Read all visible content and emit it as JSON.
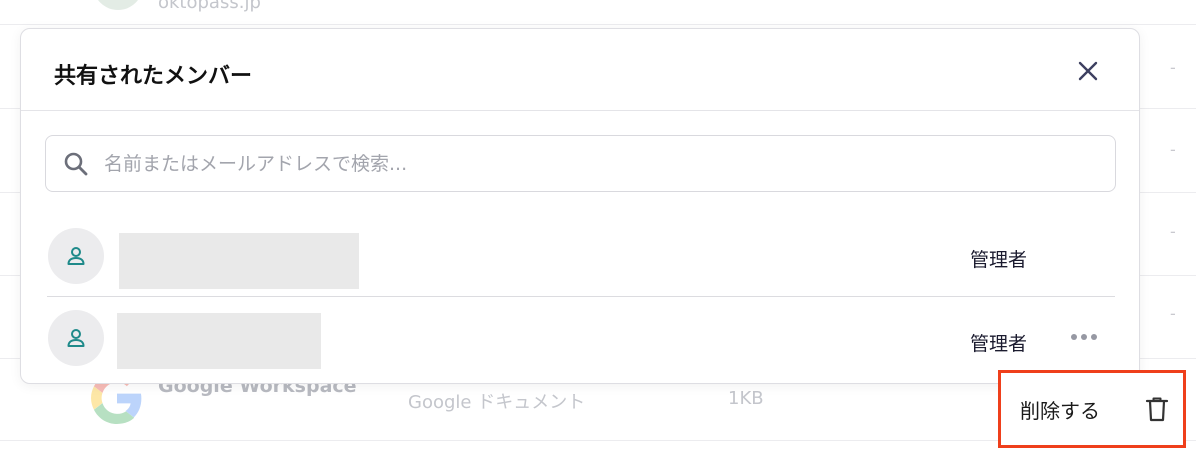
{
  "background": {
    "top_domain": "oktopass.jp",
    "row": {
      "app_name": "Google Workspace",
      "file_type": "Google ドキュメント",
      "size": "1KB"
    },
    "dash": "-"
  },
  "modal": {
    "title": "共有されたメンバー",
    "search": {
      "placeholder": "名前またはメールアドレスで検索..."
    },
    "members": [
      {
        "role": "管理者"
      },
      {
        "role": "管理者"
      }
    ]
  },
  "context_menu": {
    "delete_label": "削除する"
  },
  "colors": {
    "accent_teal": "#1f8a8a",
    "highlight_red": "#ef3f1b",
    "close_icon": "#3d4060"
  },
  "icons": [
    "close-icon",
    "search-icon",
    "user-icon",
    "more-icon",
    "trash-icon",
    "google-logo"
  ]
}
